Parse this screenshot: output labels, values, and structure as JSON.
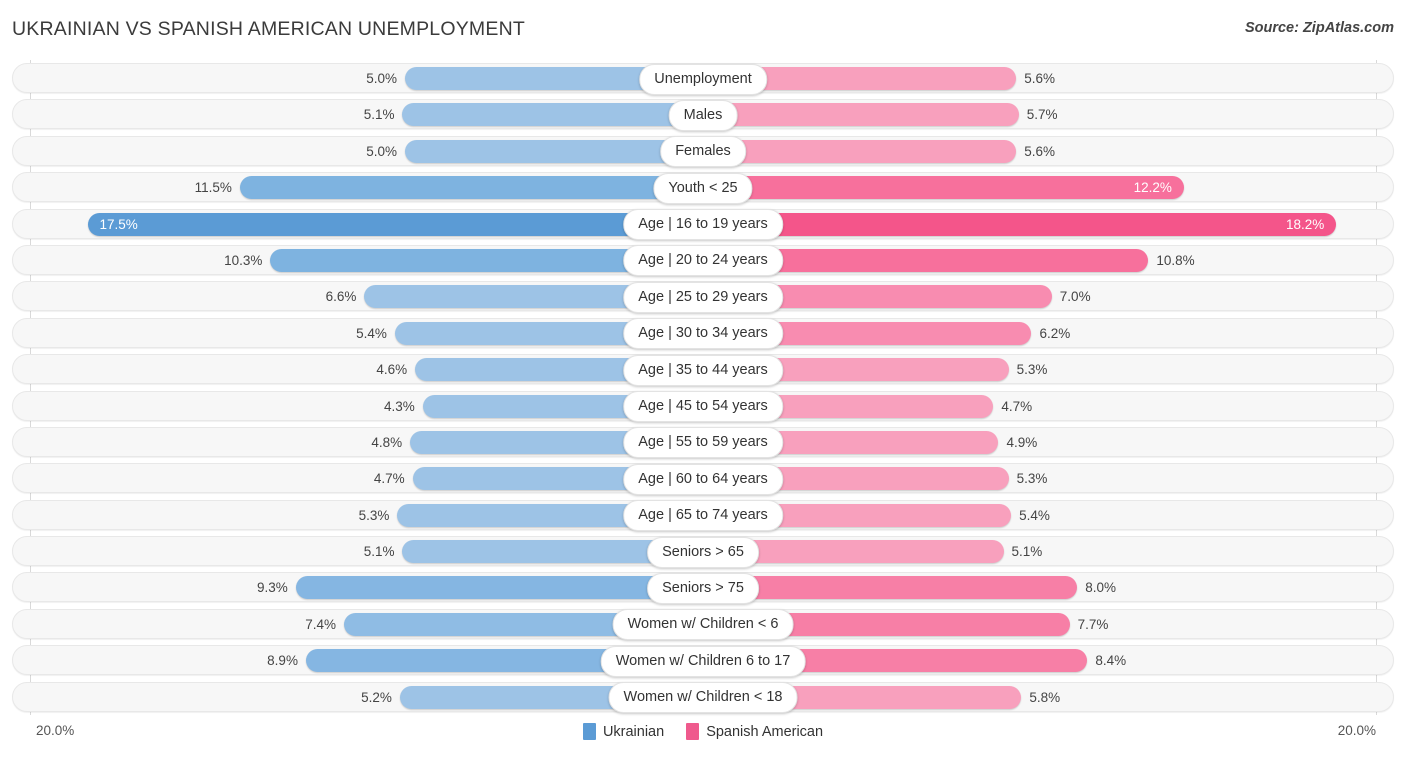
{
  "header": {
    "title": "UKRAINIAN VS SPANISH AMERICAN UNEMPLOYMENT",
    "source": "Source: ZipAtlas.com"
  },
  "axis": {
    "left_max_label": "20.0%",
    "right_max_label": "20.0%",
    "max_value": 20.0
  },
  "legend": [
    {
      "name": "ukrainian",
      "label": "Ukrainian",
      "color": "#5b9bd5"
    },
    {
      "name": "spanish-american",
      "label": "Spanish American",
      "color": "#ef5a8d"
    }
  ],
  "colors": {
    "blue_light": "#9dc3e6",
    "blue_dark": "#5b9bd5",
    "pink_light": "#f8a0bd",
    "pink_mid": "#f77fa6",
    "pink_dark": "#f4558a",
    "track_bg": "#f7f7f7",
    "track_border": "#e8e8e8",
    "gridline": "#d9d9d9"
  },
  "chart_data": {
    "type": "bar",
    "orientation": "horizontal-diverging",
    "title": "UKRAINIAN VS SPANISH AMERICAN UNEMPLOYMENT",
    "xlabel": "",
    "ylabel": "",
    "xlim": [
      20.0,
      20.0
    ],
    "grid": true,
    "legend_position": "bottom-center",
    "units": "percent",
    "categories": [
      "Unemployment",
      "Males",
      "Females",
      "Youth < 25",
      "Age | 16 to 19 years",
      "Age | 20 to 24 years",
      "Age | 25 to 29 years",
      "Age | 30 to 34 years",
      "Age | 35 to 44 years",
      "Age | 45 to 54 years",
      "Age | 55 to 59 years",
      "Age | 60 to 64 years",
      "Age | 65 to 74 years",
      "Seniors > 65",
      "Seniors > 75",
      "Women w/ Children < 6",
      "Women w/ Children 6 to 17",
      "Women w/ Children < 18"
    ],
    "series": [
      {
        "name": "Ukrainian",
        "color": "#9dc3e6",
        "values": [
          5.0,
          5.1,
          5.0,
          11.5,
          17.5,
          10.3,
          6.6,
          5.4,
          4.6,
          4.3,
          4.8,
          4.7,
          5.3,
          5.1,
          9.3,
          7.4,
          8.9,
          5.2
        ]
      },
      {
        "name": "Spanish American",
        "color": "#f8a0bd",
        "values": [
          5.6,
          5.7,
          5.6,
          12.2,
          18.2,
          10.8,
          7.0,
          6.2,
          5.3,
          4.7,
          4.9,
          5.3,
          5.4,
          5.1,
          8.0,
          7.7,
          8.4,
          5.8
        ]
      }
    ]
  },
  "rows": [
    {
      "label": "Unemployment",
      "left": {
        "value": 5.0,
        "text": "5.0%",
        "color": "#9dc3e6",
        "inside": false
      },
      "right": {
        "value": 5.6,
        "text": "5.6%",
        "color": "#f8a0bd",
        "inside": false
      }
    },
    {
      "label": "Males",
      "left": {
        "value": 5.1,
        "text": "5.1%",
        "color": "#9dc3e6",
        "inside": false
      },
      "right": {
        "value": 5.7,
        "text": "5.7%",
        "color": "#f8a0bd",
        "inside": false
      }
    },
    {
      "label": "Females",
      "left": {
        "value": 5.0,
        "text": "5.0%",
        "color": "#9dc3e6",
        "inside": false
      },
      "right": {
        "value": 5.6,
        "text": "5.6%",
        "color": "#f8a0bd",
        "inside": false
      }
    },
    {
      "label": "Youth < 25",
      "left": {
        "value": 11.5,
        "text": "11.5%",
        "color": "#7eb3e0",
        "inside": false
      },
      "right": {
        "value": 12.2,
        "text": "12.2%",
        "color": "#f7709c",
        "inside": true
      }
    },
    {
      "label": "Age | 16 to 19 years",
      "left": {
        "value": 17.5,
        "text": "17.5%",
        "color": "#5b9bd5",
        "inside": true
      },
      "right": {
        "value": 18.2,
        "text": "18.2%",
        "color": "#f4558a",
        "inside": true
      }
    },
    {
      "label": "Age | 20 to 24 years",
      "left": {
        "value": 10.3,
        "text": "10.3%",
        "color": "#7eb3e0",
        "inside": false
      },
      "right": {
        "value": 10.8,
        "text": "10.8%",
        "color": "#f7709c",
        "inside": false
      }
    },
    {
      "label": "Age | 25 to 29 years",
      "left": {
        "value": 6.6,
        "text": "6.6%",
        "color": "#9dc3e6",
        "inside": false
      },
      "right": {
        "value": 7.0,
        "text": "7.0%",
        "color": "#f88cb0",
        "inside": false
      }
    },
    {
      "label": "Age | 30 to 34 years",
      "left": {
        "value": 5.4,
        "text": "5.4%",
        "color": "#9dc3e6",
        "inside": false
      },
      "right": {
        "value": 6.2,
        "text": "6.2%",
        "color": "#f88cb0",
        "inside": false
      }
    },
    {
      "label": "Age | 35 to 44 years",
      "left": {
        "value": 4.6,
        "text": "4.6%",
        "color": "#9dc3e6",
        "inside": false
      },
      "right": {
        "value": 5.3,
        "text": "5.3%",
        "color": "#f8a0bd",
        "inside": false
      }
    },
    {
      "label": "Age | 45 to 54 years",
      "left": {
        "value": 4.3,
        "text": "4.3%",
        "color": "#9dc3e6",
        "inside": false
      },
      "right": {
        "value": 4.7,
        "text": "4.7%",
        "color": "#f8a0bd",
        "inside": false
      }
    },
    {
      "label": "Age | 55 to 59 years",
      "left": {
        "value": 4.8,
        "text": "4.8%",
        "color": "#9dc3e6",
        "inside": false
      },
      "right": {
        "value": 4.9,
        "text": "4.9%",
        "color": "#f8a0bd",
        "inside": false
      }
    },
    {
      "label": "Age | 60 to 64 years",
      "left": {
        "value": 4.7,
        "text": "4.7%",
        "color": "#9dc3e6",
        "inside": false
      },
      "right": {
        "value": 5.3,
        "text": "5.3%",
        "color": "#f8a0bd",
        "inside": false
      }
    },
    {
      "label": "Age | 65 to 74 years",
      "left": {
        "value": 5.3,
        "text": "5.3%",
        "color": "#9dc3e6",
        "inside": false
      },
      "right": {
        "value": 5.4,
        "text": "5.4%",
        "color": "#f8a0bd",
        "inside": false
      }
    },
    {
      "label": "Seniors > 65",
      "left": {
        "value": 5.1,
        "text": "5.1%",
        "color": "#9dc3e6",
        "inside": false
      },
      "right": {
        "value": 5.1,
        "text": "5.1%",
        "color": "#f8a0bd",
        "inside": false
      }
    },
    {
      "label": "Seniors > 75",
      "left": {
        "value": 9.3,
        "text": "9.3%",
        "color": "#85b6e2",
        "inside": false
      },
      "right": {
        "value": 8.0,
        "text": "8.0%",
        "color": "#f77fa6",
        "inside": false
      }
    },
    {
      "label": "Women w/ Children < 6",
      "left": {
        "value": 7.4,
        "text": "7.4%",
        "color": "#8fbce4",
        "inside": false
      },
      "right": {
        "value": 7.7,
        "text": "7.7%",
        "color": "#f77fa6",
        "inside": false
      }
    },
    {
      "label": "Women w/ Children 6 to 17",
      "left": {
        "value": 8.9,
        "text": "8.9%",
        "color": "#85b6e2",
        "inside": false
      },
      "right": {
        "value": 8.4,
        "text": "8.4%",
        "color": "#f77fa6",
        "inside": false
      }
    },
    {
      "label": "Women w/ Children < 18",
      "left": {
        "value": 5.2,
        "text": "5.2%",
        "color": "#9dc3e6",
        "inside": false
      },
      "right": {
        "value": 5.8,
        "text": "5.8%",
        "color": "#f8a0bd",
        "inside": false
      }
    }
  ]
}
